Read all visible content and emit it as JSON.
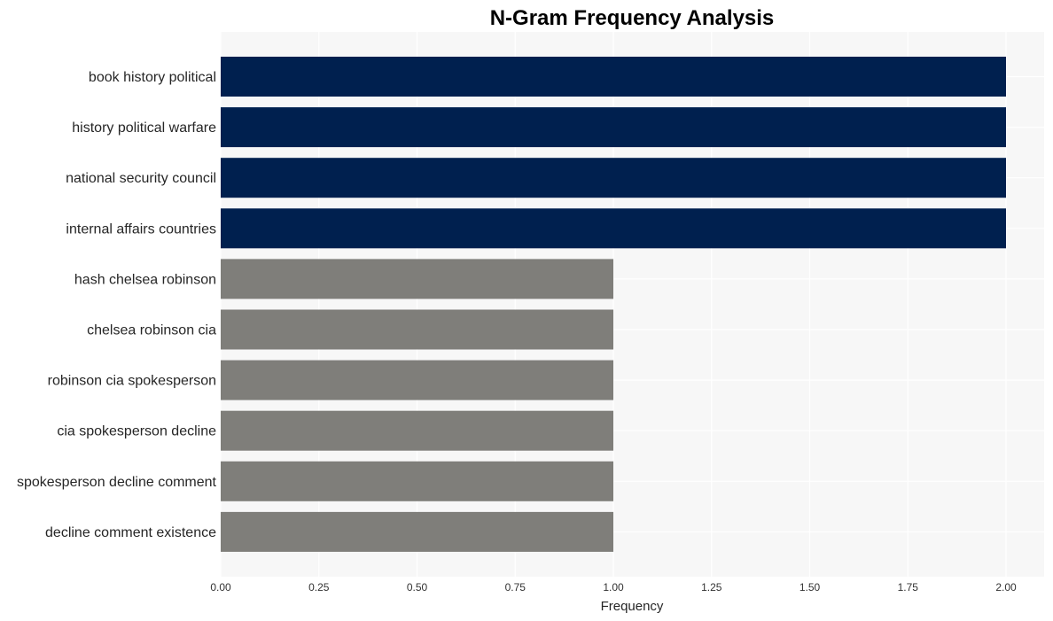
{
  "chart_data": {
    "type": "bar",
    "orientation": "horizontal",
    "title": "N-Gram Frequency Analysis",
    "xlabel": "Frequency",
    "ylabel": "",
    "xlim": [
      0,
      2.1
    ],
    "xticks": [
      "0.00",
      "0.25",
      "0.50",
      "0.75",
      "1.00",
      "1.25",
      "1.50",
      "1.75",
      "2.00"
    ],
    "tick_values": [
      0,
      0.25,
      0.5,
      0.75,
      1.0,
      1.25,
      1.5,
      1.75,
      2.0
    ],
    "grid": true,
    "categories": [
      "book history political",
      "history political warfare",
      "national security council",
      "internal affairs countries",
      "hash chelsea robinson",
      "chelsea robinson cia",
      "robinson cia spokesperson",
      "cia spokesperson decline",
      "spokesperson decline comment",
      "decline comment existence"
    ],
    "values": [
      2,
      2,
      2,
      2,
      1,
      1,
      1,
      1,
      1,
      1
    ],
    "colors": {
      "highlight": "#00204f",
      "default": "#7f7e7a",
      "panel_background": "#f7f7f7",
      "gridline": "#ffffff"
    }
  }
}
